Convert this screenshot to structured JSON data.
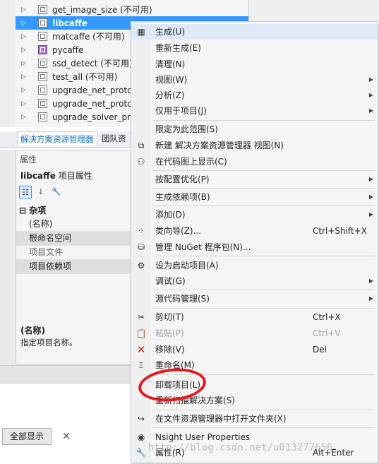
{
  "solution_explorer": {
    "items": [
      {
        "label": "get_image_size (不可用)"
      },
      {
        "label": "libcaffe",
        "selected": true
      },
      {
        "label": "matcaffe (不可用)"
      },
      {
        "label": "pycaffe",
        "icon": "python-project-icon"
      },
      {
        "label": "ssd_detect (不可用)"
      },
      {
        "label": "test_all (不可用)"
      },
      {
        "label": "upgrade_net_protc"
      },
      {
        "label": "upgrade_net_protc"
      },
      {
        "label": "upgrade_solver_pr"
      }
    ]
  },
  "tabs": {
    "solution_explorer": "解决方案资源管理器",
    "team": "团队资"
  },
  "properties": {
    "caption": "属性",
    "subject_name": "libcaffe",
    "subject_type": "项目属性",
    "category": "杂项",
    "rows": [
      {
        "name": "(名称)"
      },
      {
        "name": "根命名空间"
      },
      {
        "name": "项目文件"
      },
      {
        "name": "项目依赖项"
      }
    ],
    "description_title": "(名称)",
    "description": "指定项目名称。"
  },
  "bottom": {
    "show_all_label": "全部显示",
    "close_glyph": "✕"
  },
  "context_menu": {
    "items": [
      {
        "label": "生成(U)",
        "icon": "build-icon",
        "hover": true
      },
      {
        "label": "重新生成(E)"
      },
      {
        "label": "清理(N)"
      },
      {
        "label": "视图(W)",
        "submenu": true
      },
      {
        "label": "分析(Z)",
        "submenu": true
      },
      {
        "label": "仅用于项目(J)",
        "submenu": true
      },
      {
        "label": "限定为此范围(S)"
      },
      {
        "label": "新建 解决方案资源管理器 视图(N)",
        "icon": "new-view-icon"
      },
      {
        "label": "在代码图上显示(C)",
        "icon": "code-map-icon"
      },
      {
        "label": "按配置优化(P)",
        "submenu": true
      },
      {
        "label": "生成依赖项(B)",
        "submenu": true
      },
      {
        "label": "添加(D)",
        "submenu": true
      },
      {
        "label": "类向导(Z)...",
        "shortcut": "Ctrl+Shift+X",
        "icon": "class-wizard-icon"
      },
      {
        "label": "管理 NuGet 程序包(N)...",
        "icon": "nuget-icon"
      },
      {
        "label": "设为启动项目(A)",
        "icon": "gear-icon"
      },
      {
        "label": "调试(G)",
        "submenu": true
      },
      {
        "label": "源代码管理(S)",
        "submenu": true
      },
      {
        "label": "剪切(T)",
        "shortcut": "Ctrl+X",
        "icon": "scissors-icon"
      },
      {
        "label": "粘贴(P)",
        "shortcut": "Ctrl+V",
        "icon": "paste-icon",
        "disabled": true
      },
      {
        "label": "移除(V)",
        "shortcut": "Del",
        "icon": "remove-x-icon"
      },
      {
        "label": "重命名(M)",
        "icon": "rename-icon"
      },
      {
        "label": "卸载项目(L)"
      },
      {
        "label": "重新扫描解决方案(S)"
      },
      {
        "label": "在文件资源管理器中打开文件夹(X)",
        "icon": "open-folder-icon"
      },
      {
        "label": "Nsight User Properties",
        "icon": "nsight-icon"
      },
      {
        "label": "属性(R)",
        "shortcut": "Alt+Enter",
        "icon": "wrench-icon"
      }
    ]
  },
  "watermark": "http://blog.csdn.net/u013277656",
  "colors": {
    "selection": "#3399ff",
    "annotation_oval": "#e8171d",
    "remove_icon": "#c42b1c"
  }
}
